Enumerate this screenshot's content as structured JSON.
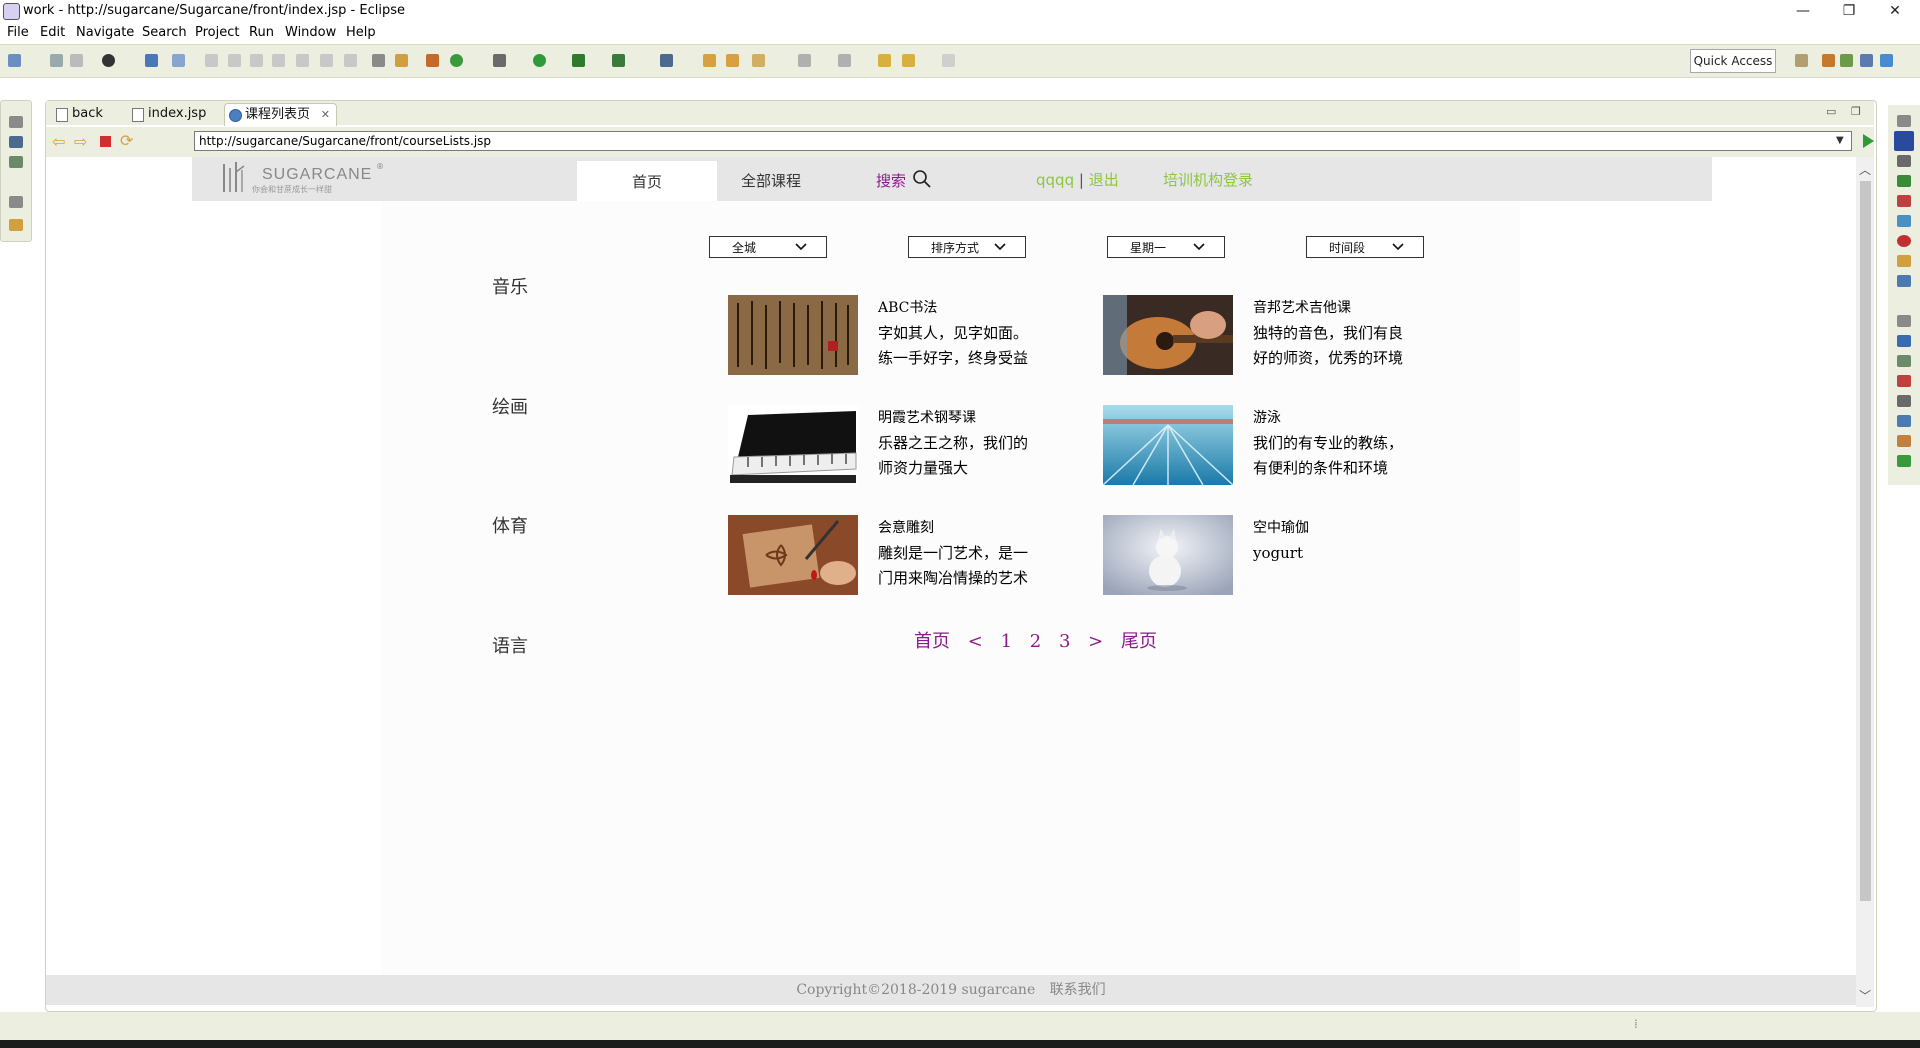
{
  "window": {
    "title": "work - http://sugarcane/Sugarcane/front/index.jsp - Eclipse",
    "minimize": "—",
    "restore": "❐",
    "close": "✕"
  },
  "menu": [
    "File",
    "Edit",
    "Navigate",
    "Search",
    "Project",
    "Run",
    "Window",
    "Help"
  ],
  "toolbar": {
    "quick_access": "Quick Access"
  },
  "editor_tabs": [
    {
      "label": "back",
      "active": false
    },
    {
      "label": "index.jsp",
      "active": false
    },
    {
      "label": "课程列表页",
      "active": true
    }
  ],
  "browser": {
    "url": "http://sugarcane/Sugarcane/front/courseLists.jsp"
  },
  "site": {
    "logo_text": "SUGARCANE",
    "logo_registered": "®",
    "logo_slogan": "你会和甘蔗成长一样甜",
    "nav": {
      "home": "首页",
      "all_courses": "全部课程",
      "search": "搜索",
      "user": "qqqq",
      "separator": "|",
      "logout": "退出",
      "org_login": "培训机构登录"
    },
    "filters": [
      "全城",
      "排序方式",
      "星期一",
      "时间段"
    ],
    "categories": [
      "音乐",
      "绘画",
      "体育",
      "语言"
    ],
    "courses": [
      {
        "name": "ABC书法",
        "desc": "字如其人，见字如面。练一手好字，终身受益",
        "image": "calligraphy"
      },
      {
        "name": "音邦艺术吉他课",
        "desc": "独特的音色，我们有良好的师资，优秀的环境",
        "image": "guitar"
      },
      {
        "name": "明霞艺术钢琴课",
        "desc": "乐器之王之称，我们的师资力量强大",
        "image": "piano"
      },
      {
        "name": "游泳",
        "desc": "我们的有专业的教练，有便利的条件和环境",
        "image": "swimming-pool"
      },
      {
        "name": "会意雕刻",
        "desc": "雕刻是一门艺术，是一门用来陶冶情操的艺术",
        "image": "wood-carving"
      },
      {
        "name": "空中瑜伽",
        "desc": "yogurt",
        "image": "cat"
      }
    ],
    "pager": [
      "首页",
      "<",
      "1",
      "2",
      "3",
      ">",
      "尾页"
    ],
    "footer": {
      "copyright": "Copyright©2018-2019   sugarcane",
      "contact": "联系我们"
    }
  },
  "colors": {
    "toolbar_bg": "#eceee0",
    "accent_purple": "#8b1a8b",
    "accent_green": "#8dc63f",
    "header_grey": "#e6e6e6"
  }
}
